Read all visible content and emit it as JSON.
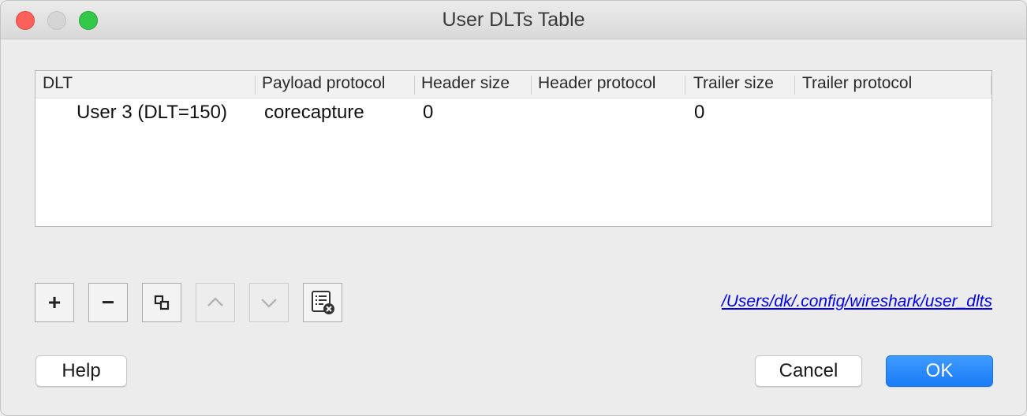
{
  "window": {
    "title": "User DLTs Table"
  },
  "table": {
    "columns": [
      "DLT",
      "Payload protocol",
      "Header size",
      "Header protocol",
      "Trailer size",
      "Trailer protocol"
    ],
    "rows": [
      {
        "dlt": "User 3 (DLT=150)",
        "payload_protocol": "corecapture",
        "header_size": "0",
        "header_protocol": "",
        "trailer_size": "0",
        "trailer_protocol": ""
      }
    ]
  },
  "toolbar": {
    "buttons": [
      {
        "icon": "plus-icon",
        "glyph": "+",
        "enabled": true
      },
      {
        "icon": "minus-icon",
        "glyph": "−",
        "enabled": true
      },
      {
        "icon": "copy-icon",
        "enabled": true
      },
      {
        "icon": "chevron-up-icon",
        "enabled": false
      },
      {
        "icon": "chevron-down-icon",
        "enabled": false
      },
      {
        "icon": "clear-list-icon",
        "enabled": true
      }
    ]
  },
  "file_path": "/Users/dk/.config/wireshark/user_dlts",
  "buttons": {
    "help": "Help",
    "cancel": "Cancel",
    "ok": "OK"
  },
  "colors": {
    "accent": "#1a7cf7",
    "link": "#0000ee",
    "close": "#fc605b",
    "zoom": "#34c84a"
  }
}
